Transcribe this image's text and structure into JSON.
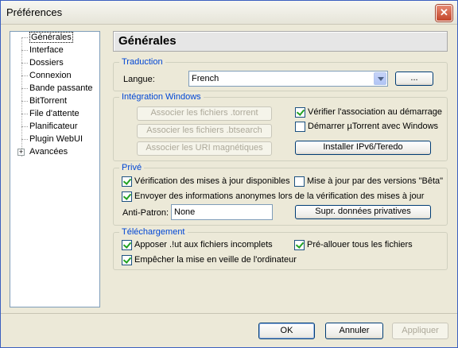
{
  "window": {
    "title": "Préférences"
  },
  "tree": {
    "items": [
      {
        "label": "Générales",
        "selected": true
      },
      {
        "label": "Interface"
      },
      {
        "label": "Dossiers"
      },
      {
        "label": "Connexion"
      },
      {
        "label": "Bande passante"
      },
      {
        "label": "BitTorrent"
      },
      {
        "label": "File d'attente"
      },
      {
        "label": "Planificateur"
      },
      {
        "label": "Plugin WebUI"
      },
      {
        "label": "Avancées",
        "expandable": true
      }
    ]
  },
  "panel": {
    "title": "Générales"
  },
  "translation": {
    "legend": "Traduction",
    "language_label": "Langue:",
    "language_value": "French",
    "browse_label": "..."
  },
  "windows_integration": {
    "legend": "Intégration Windows",
    "assoc_torrent": "Associer les fichiers .torrent",
    "assoc_btsearch": "Associer les fichiers .btsearch",
    "assoc_magnet": "Associer les URI magnétiques",
    "check_assoc": "Vérifier l'association au démarrage",
    "start_with_windows": "Démarrer µTorrent avec Windows",
    "install_ipv6": "Installer IPv6/Teredo"
  },
  "privacy": {
    "legend": "Privé",
    "check_updates": "Vérification des mises à jour disponibles",
    "beta_updates": "Mise à jour par des versions \"Bêta\"",
    "anon_info": "Envoyer des informations anonymes lors de la vérification des mises à jour",
    "antipatron_label": "Anti-Patron:",
    "antipatron_value": "None",
    "delete_private": "Supr. données privatives"
  },
  "download": {
    "legend": "Téléchargement",
    "append_ut": "Apposer .!ut aux fichiers incomplets",
    "prealloc": "Pré-allouer tous les fichiers",
    "prevent_standby": "Empêcher la mise en veille de l'ordinateur"
  },
  "footer": {
    "ok": "OK",
    "cancel": "Annuler",
    "apply": "Appliquer"
  }
}
